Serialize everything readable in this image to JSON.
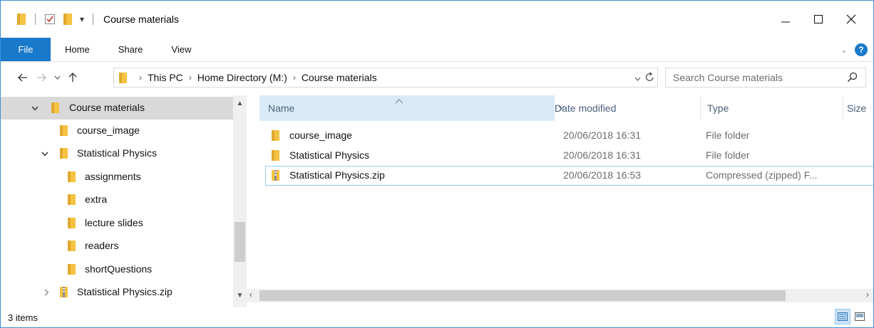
{
  "window": {
    "title": "Course materials",
    "accent": "#1979ca",
    "controls": {
      "minimize_icon": "minimize-icon",
      "maximize_icon": "maximize-icon",
      "close_icon": "close-icon"
    }
  },
  "ribbon": {
    "tabs": [
      {
        "label": "File",
        "active": true
      },
      {
        "label": "Home"
      },
      {
        "label": "Share"
      },
      {
        "label": "View"
      }
    ]
  },
  "address": {
    "breadcrumb": [
      "This PC",
      "Home Directory (M:)",
      "Course materials"
    ],
    "search_placeholder": "Search Course materials"
  },
  "nav_tree": [
    {
      "label": "Course materials",
      "level": 0,
      "expanded": true,
      "selected": true,
      "icon": "folder-icon"
    },
    {
      "label": "course_image",
      "level": 1,
      "icon": "folder-icon"
    },
    {
      "label": "Statistical Physics",
      "level": 1,
      "expanded": true,
      "icon": "folder-icon"
    },
    {
      "label": "assignments",
      "level": 2,
      "icon": "folder-icon"
    },
    {
      "label": "extra",
      "level": 2,
      "icon": "folder-icon"
    },
    {
      "label": "lecture slides",
      "level": 2,
      "icon": "folder-icon"
    },
    {
      "label": "readers",
      "level": 2,
      "icon": "folder-icon"
    },
    {
      "label": "shortQuestions",
      "level": 2,
      "icon": "folder-icon"
    },
    {
      "label": "Statistical Physics.zip",
      "level": 1,
      "expanded": false,
      "icon": "zip-folder-icon"
    }
  ],
  "columns": {
    "name": "Name",
    "date": "Date modified",
    "type": "Type",
    "size": "Size"
  },
  "files": [
    {
      "name": "course_image",
      "date": "20/06/2018 16:31",
      "type": "File folder",
      "icon": "folder-icon"
    },
    {
      "name": "Statistical Physics",
      "date": "20/06/2018 16:31",
      "type": "File folder",
      "icon": "folder-icon"
    },
    {
      "name": "Statistical Physics.zip",
      "date": "20/06/2018 16:53",
      "type": "Compressed (zipped) F...",
      "icon": "zip-folder-icon",
      "focused": true
    }
  ],
  "status": {
    "items_count": "3 items"
  }
}
